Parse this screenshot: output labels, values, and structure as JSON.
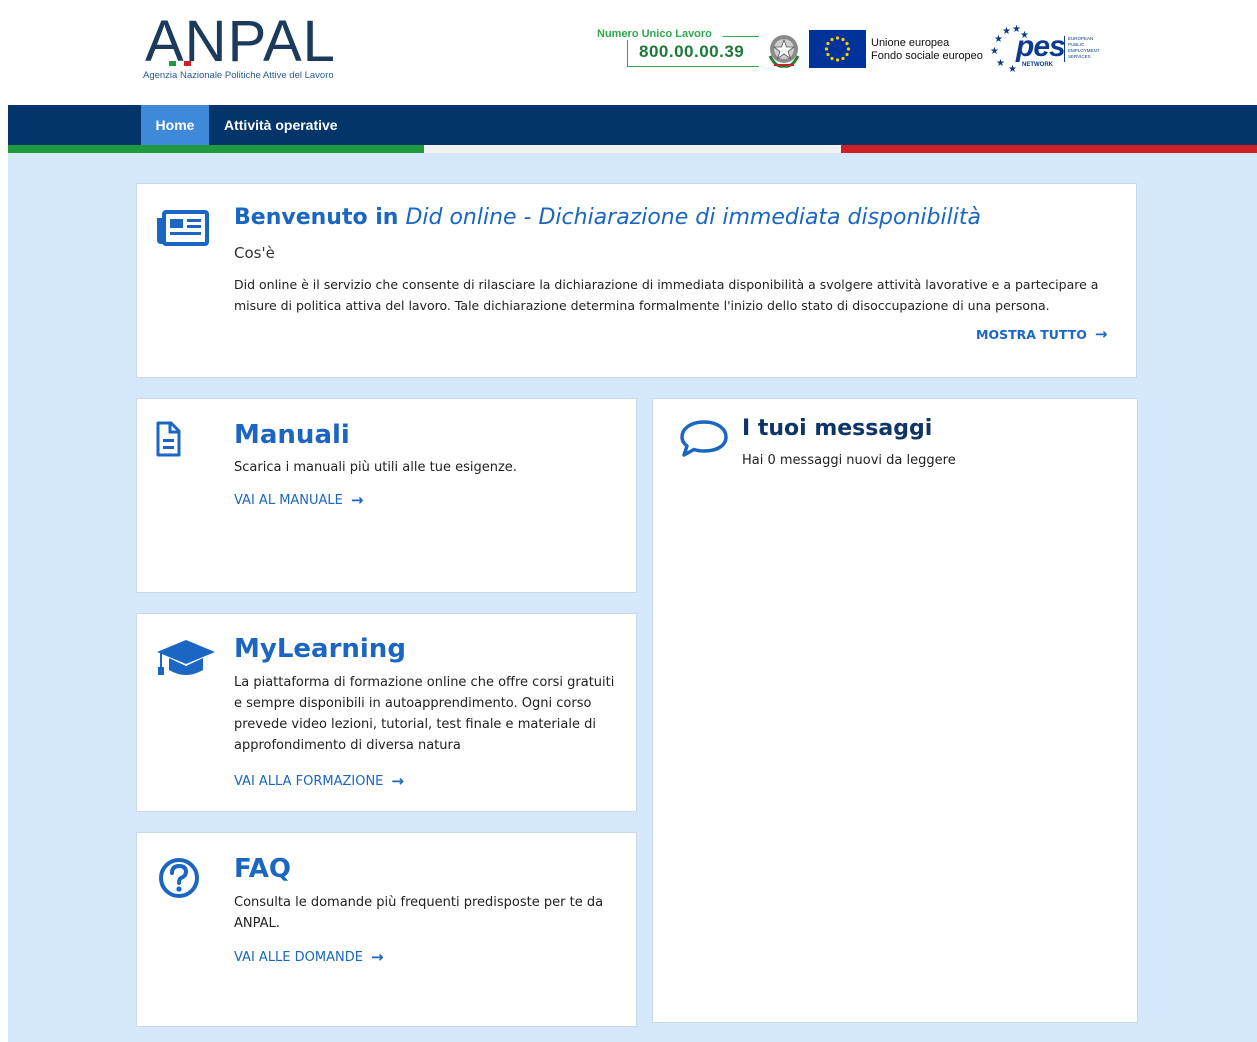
{
  "header": {
    "logo": {
      "wordmark": "ANPAL",
      "subtitle": "Agenzia Nazionale Politiche Attive del Lavoro"
    },
    "numero_unico": {
      "label": "Numero Unico Lavoro",
      "value": "800.00.00.39"
    },
    "eu": {
      "line1": "Unione europea",
      "line2": "Fondo sociale europeo"
    },
    "pes": {
      "word": "pes",
      "network": "NETWORK",
      "small_lines": [
        "EUROPEAN",
        "PUBLIC",
        "EMPLOYMENT",
        "SERVICES"
      ]
    }
  },
  "nav": {
    "items": [
      {
        "label": "Home",
        "active": true
      },
      {
        "label": "Attività operative",
        "active": false
      }
    ]
  },
  "colors": {
    "nav_bg": "#03346a",
    "nav_active": "#3e8ad8",
    "accent_blue": "#1a66c2",
    "page_bg": "#d6e8fb",
    "flag_green": "#1f9a3e",
    "flag_white": "#f2f2f2",
    "flag_red": "#cf2027"
  },
  "welcome": {
    "title_bold": "Benvenuto in",
    "title_italic": "Did online - Dichiarazione di immediata disponibilità",
    "subtitle": "Cos'è",
    "text": "Did online è il servizio che consente di rilasciare la dichiarazione di immediata disponibilità a svolgere attività lavorative e a partecipare a misure di politica attiva del lavoro. Tale dichiarazione determina formalmente l'inizio dello stato di disoccupazione di una persona.",
    "link": "MOSTRA TUTTO",
    "icon": "newspaper-icon"
  },
  "manuali": {
    "title": "Manuali",
    "text": "Scarica i manuali più utili alle tue esigenze.",
    "link": "VAI AL MANUALE",
    "icon": "document-icon"
  },
  "mylearning": {
    "title": "MyLearning",
    "text": "La piattaforma di formazione online che offre corsi gratuiti e sempre disponibili in autoapprendimento. Ogni corso prevede video lezioni, tutorial, test finale e materiale di approfondimento di diversa natura",
    "link": "VAI ALLA FORMAZIONE",
    "icon": "graduation-cap-icon"
  },
  "faq": {
    "title": "FAQ",
    "text": "Consulta le domande più frequenti predisposte per te da ANPAL.",
    "link": "VAI ALLE DOMANDE",
    "icon": "question-circle-icon"
  },
  "messaggi": {
    "title": "I tuoi messaggi",
    "text": "Hai 0 messaggi nuovi da leggere",
    "icon": "speech-bubble-icon"
  }
}
